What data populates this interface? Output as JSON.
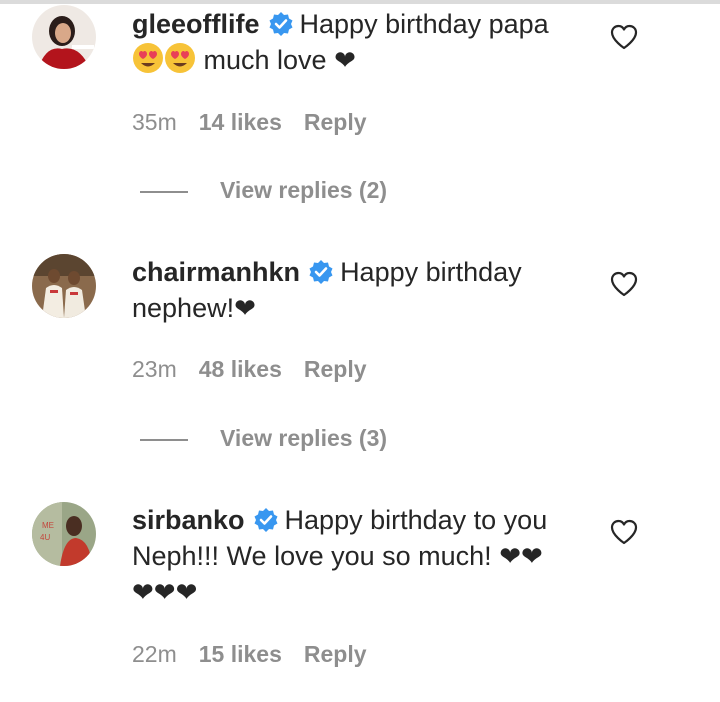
{
  "comments": [
    {
      "username": "gleeofflife",
      "text_before": "Happy birthday papa",
      "emojis": [
        "smiling-face-with-heart-eyes",
        "smiling-face-with-heart-eyes"
      ],
      "text_after": "much love",
      "time": "35m",
      "likes": "14 likes",
      "reply": "Reply",
      "view_replies": "View replies (2)"
    },
    {
      "username": "chairmanhkn",
      "text_before": "Happy birthday nephew!",
      "time": "23m",
      "likes": "48 likes",
      "reply": "Reply",
      "view_replies": "View replies (3)"
    },
    {
      "username": "sirbanko",
      "text_before": "Happy birthday to you Neph!!! We love you so much!",
      "time": "22m",
      "likes": "15 likes",
      "reply": "Reply"
    }
  ],
  "colors": {
    "verified": "#3897f0",
    "meta": "#8e8e8e",
    "text": "#262626"
  },
  "icons": [
    "verified-badge-icon",
    "heart-outline-icon",
    "black-heart-emoji",
    "heart-eyes-emoji"
  ]
}
